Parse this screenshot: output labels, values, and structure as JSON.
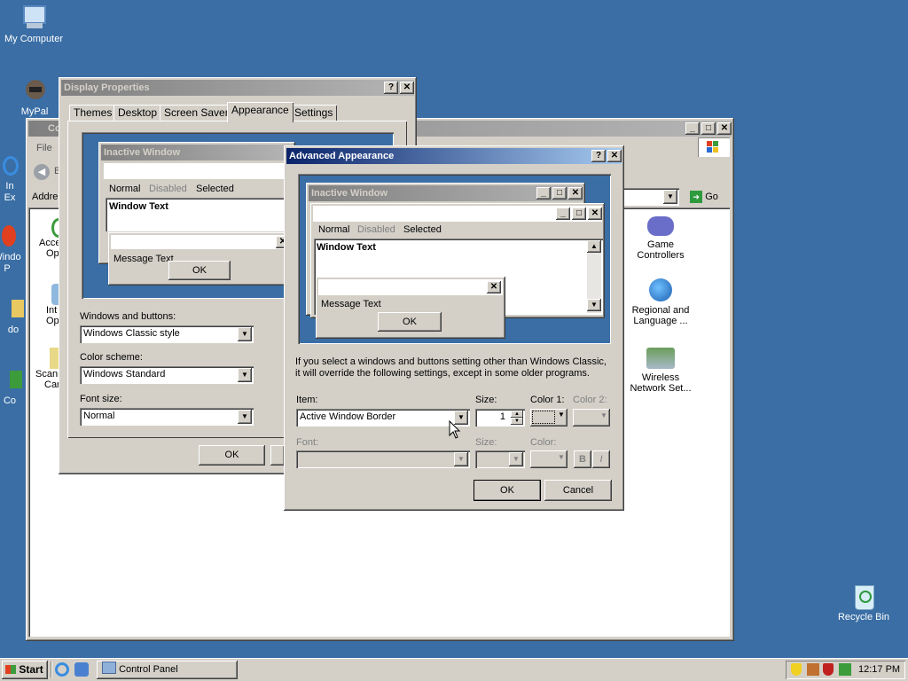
{
  "desktop": {
    "icons": {
      "my_computer": "My Computer",
      "mypal": "MyPal",
      "recycle_bin": "Recycle Bin",
      "ie_a": "In",
      "ie_b": "Ex",
      "wu_a": "Windo",
      "wu_b": "P",
      "doc_a": "do",
      "co_a": "Co"
    }
  },
  "control_panel": {
    "title": "Co",
    "menu_file": "File",
    "back_label": "B",
    "address_label": "Addre",
    "go_label": "Go",
    "items": {
      "accessibility_a": "Acce",
      "accessibility_b": "Op",
      "internet_a": "Int",
      "internet_b": "Op",
      "scanners_a": "Scanr",
      "scanners_b": "Car",
      "game": "Game Controllers",
      "regional": "Regional and Language ...",
      "wireless": "Wireless Network Set..."
    }
  },
  "display_properties": {
    "title": "Display Properties",
    "tabs": [
      "Themes",
      "Desktop",
      "Screen Saver",
      "Appearance",
      "Settings"
    ],
    "preview": {
      "inactive_title": "Inactive Window",
      "menu": [
        "Normal",
        "Disabled",
        "Selected"
      ],
      "window_text": "Window Text",
      "message_text": "Message Text",
      "ok": "OK"
    },
    "windows_buttons_label": "Windows and buttons:",
    "windows_buttons_value": "Windows Classic style",
    "color_scheme_label": "Color scheme:",
    "color_scheme_value": "Windows Standard",
    "font_size_label": "Font size:",
    "font_size_value": "Normal",
    "ok": "OK"
  },
  "advanced": {
    "title": "Advanced Appearance",
    "preview": {
      "inactive_title": "Inactive Window",
      "menu": [
        "Normal",
        "Disabled",
        "Selected"
      ],
      "window_text": "Window Text",
      "message_text": "Message Text",
      "ok": "OK"
    },
    "note_line1": "If you select a windows and buttons setting other than Windows Classic,",
    "note_line2": "it will override the following settings, except in some older programs.",
    "item_label": "Item:",
    "item_value": "Active Window Border",
    "size_label": "Size:",
    "size_value": "1",
    "color1_label": "Color 1:",
    "color2_label": "Color 2:",
    "font_label": "Font:",
    "font_size_label": "Size:",
    "font_color_label": "Color:",
    "bold": "B",
    "italic": "I",
    "ok": "OK",
    "cancel": "Cancel"
  },
  "taskbar": {
    "start": "Start",
    "task": "Control Panel",
    "clock": "12:17 PM"
  },
  "colors": {
    "desktop": "#3a6ea5",
    "active_title": "#0a246a",
    "inactive_title": "#808080",
    "face": "#d4d0c8"
  }
}
